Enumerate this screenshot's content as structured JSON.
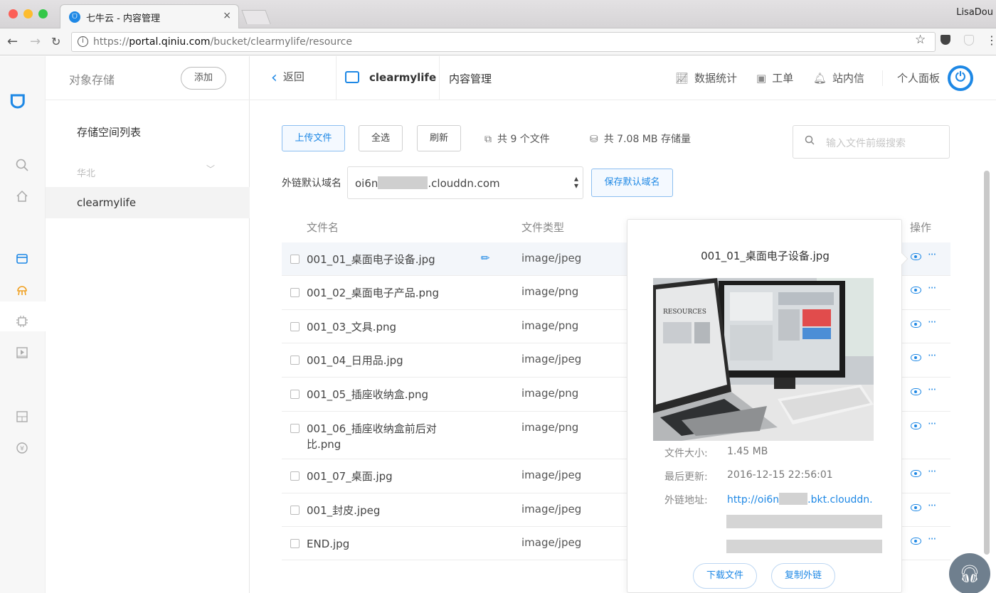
{
  "browser": {
    "tab_title": "七牛云 - 内容管理",
    "tab_close": "×",
    "user": "LisaDou",
    "url_prefix": "https://",
    "url_host": "portal.qiniu.com",
    "url_path": "/bucket/clearmylife/resource"
  },
  "rail": {
    "icons": [
      "logo-icon",
      "search-icon",
      "home-icon",
      "bucket-icon",
      "robot-icon",
      "chip-icon",
      "media-icon",
      "grid-icon",
      "coin-icon"
    ]
  },
  "sidebar": {
    "title": "对象存储",
    "add_label": "添加",
    "section": "存储空间列表",
    "region": "华北",
    "bucket": "clearmylife"
  },
  "topnav": {
    "back": "返回",
    "bucket": "clearmylife",
    "content_mgmt": "内容管理",
    "stats": "数据统计",
    "ticket": "工单",
    "messages": "站内信",
    "panel": "个人面板"
  },
  "toolbar": {
    "upload": "上传文件",
    "select_all": "全选",
    "refresh": "刷新",
    "file_count": "共 9 个文件",
    "storage": "共 7.08 MB 存储量",
    "search_placeholder": "输入文件前缀搜索"
  },
  "domain": {
    "label": "外链默认域名",
    "value_start": "oi6n",
    "value_end": ".clouddn.com",
    "save": "保存默认域名"
  },
  "table": {
    "headers": {
      "name": "文件名",
      "type": "文件类型",
      "ops": "操作"
    },
    "rows": [
      {
        "name": "001_01_桌面电子设备.jpg",
        "type": "image/jpeg"
      },
      {
        "name": "001_02_桌面电子产品.png",
        "type": "image/png"
      },
      {
        "name": "001_03_文具.png",
        "type": "image/png"
      },
      {
        "name": "001_04_日用品.jpg",
        "type": "image/jpeg"
      },
      {
        "name": "001_05_插座收纳盒.png",
        "type": "image/png"
      },
      {
        "name": "001_06_插座收纳盒前后对比.png",
        "type": "image/png"
      },
      {
        "name": "001_07_桌面.jpg",
        "type": "image/jpeg"
      },
      {
        "name": "001_封皮.jpeg",
        "type": "image/jpeg"
      },
      {
        "name": "END.jpg",
        "type": "image/jpeg"
      }
    ]
  },
  "preview": {
    "title": "001_01_桌面电子设备.jpg",
    "screen_text": "RESOURCES",
    "size_label": "文件大小:",
    "size": "1.45 MB",
    "updated_label": "最后更新:",
    "updated": "2016-12-15 22:56:01",
    "link_label": "外链地址:",
    "link_start": "http://oi6n",
    "link_end": ".bkt.clouddn.",
    "download": "下载文件",
    "copy_link": "复制外链"
  },
  "colors": {
    "accent": "#1e88e5",
    "row_highlight": "#f3f6fa"
  }
}
